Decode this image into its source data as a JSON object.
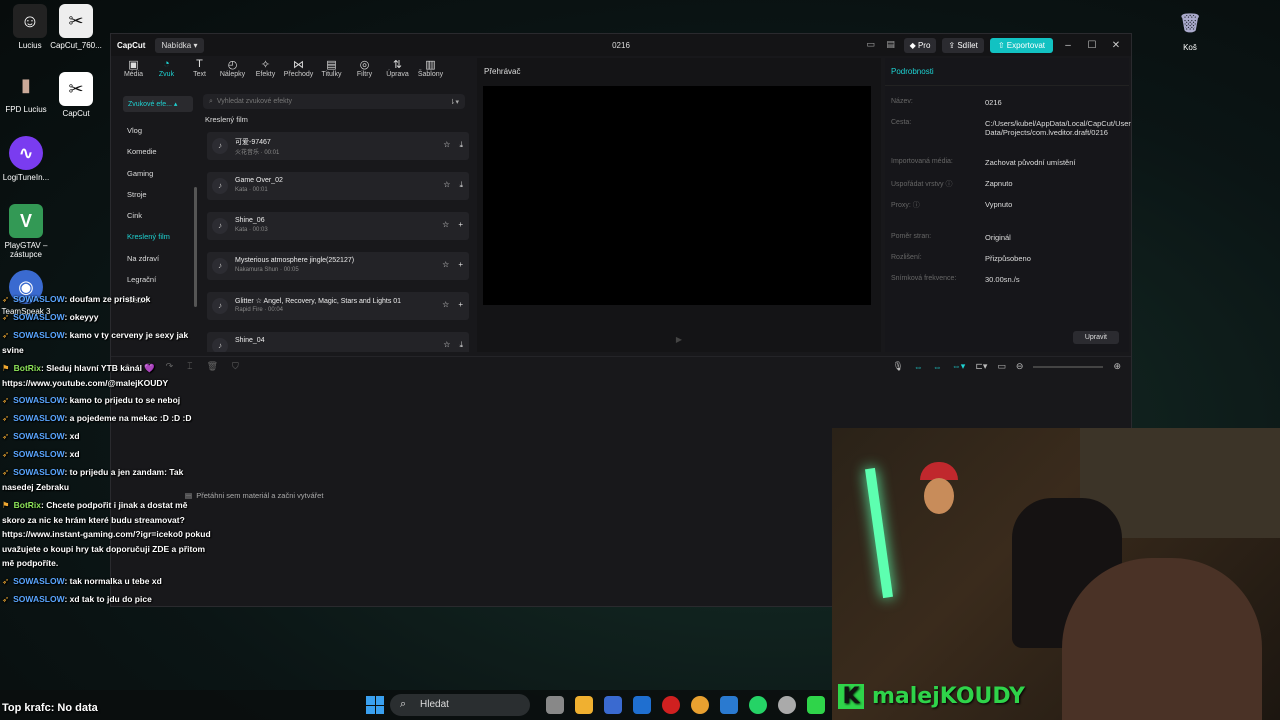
{
  "desktop": {
    "icons": [
      {
        "label": "Lucius",
        "glyph": "☺",
        "color": "#222"
      },
      {
        "label": "CapCut_760...",
        "glyph": "✂",
        "color": "#eee"
      },
      {
        "label": "FPD Lucius",
        "glyph": "▮",
        "color": "#444"
      },
      {
        "label": "CapCut",
        "glyph": "✂",
        "color": "#fff"
      },
      {
        "label": "LogiTuneIn...",
        "glyph": "∿",
        "color": "#7a3cf0"
      },
      {
        "label": "PlayGTAV – zástupce",
        "glyph": "V",
        "color": "#395"
      },
      {
        "label": "TeamSpeak 3",
        "glyph": "◉",
        "color": "#3a6ad0"
      },
      {
        "label": "Koš",
        "glyph": "🗑",
        "color": "#aac"
      }
    ]
  },
  "app": {
    "logo": "CapCut",
    "menu_label": "Nabídka",
    "project_title": "0216",
    "pro_label": "Pro",
    "share_label": "Sdílet",
    "export_label": "Exportovat"
  },
  "tools": [
    {
      "label": "Média",
      "glyph": "▣"
    },
    {
      "label": "Zvuk",
      "glyph": "◔"
    },
    {
      "label": "Text",
      "glyph": "T"
    },
    {
      "label": "Nálepky",
      "glyph": "◴"
    },
    {
      "label": "Efekty",
      "glyph": "✧"
    },
    {
      "label": "Přechody",
      "glyph": "⋈"
    },
    {
      "label": "Titulky",
      "glyph": "▤"
    },
    {
      "label": "Filtry",
      "glyph": "◎"
    },
    {
      "label": "Úprava",
      "glyph": "⇅"
    },
    {
      "label": "Šablony",
      "glyph": "▥"
    }
  ],
  "sidebar": {
    "dropdown": "Zvukové efe...",
    "categories": [
      "Vlog",
      "Komedie",
      "Gaming",
      "Stroje",
      "Cink",
      "Kreslený film",
      "Na zdraví",
      "Legrační",
      "Město"
    ],
    "active": "Kreslený film"
  },
  "audio": {
    "search_placeholder": "Vyhledat zvukové efekty",
    "section": "Kreslený film",
    "tracks": [
      {
        "name": "可爱-97467",
        "meta": "火花音乐 · 00:01"
      },
      {
        "name": "Game Over_02",
        "meta": "Kata · 00:01"
      },
      {
        "name": "Shine_06",
        "meta": "Kata · 00:03"
      },
      {
        "name": "Mysterious atmosphere jingle(252127)",
        "meta": "Nakamura Shun · 00:05"
      },
      {
        "name": "Glitter ☆ Angel, Recovery, Magic, Stars and Lights 01",
        "meta": "Rapid Fire · 00:04"
      },
      {
        "name": "Shine_04",
        "meta": ""
      }
    ]
  },
  "player": {
    "title": "Přehrávač"
  },
  "details": {
    "title": "Podrobnosti",
    "rows": [
      {
        "key": "Název:",
        "value": "0216"
      },
      {
        "key": "Cesta:",
        "value": "C:/Users/kubel/AppData/Local/CapCut/User Data/Projects/com.lveditor.draft/0216"
      },
      {
        "key": "Importovaná média:",
        "value": "Zachovat původní umístění"
      },
      {
        "key": "Uspořádat vrstvy ⓘ",
        "value": "Zapnuto"
      },
      {
        "key": "Proxy: ⓘ",
        "value": "Vypnuto"
      },
      {
        "key": "Poměr stran:",
        "value": "Originál"
      },
      {
        "key": "Rozlišení:",
        "value": "Přizpůsobeno"
      },
      {
        "key": "Snímková frekvence:",
        "value": "30.00sn./s"
      }
    ],
    "edit_label": "Upravit"
  },
  "timeline": {
    "drop_hint": "Přetáhni sem materiál a začni vytvářet"
  },
  "chat": [
    {
      "user": "SOWASLOW",
      "text": ": doufam ze pristi rok",
      "bot": false
    },
    {
      "user": "SOWASLOW",
      "text": ": okeyyy",
      "bot": false
    },
    {
      "user": "SOWASLOW",
      "text": ": kamo v ty cerveny je sexy jak svine",
      "bot": false
    },
    {
      "user": "BotRix",
      "text": ": Sleduj hlavní YTB kanál 💜 https://www.youtube.com/@malejKOUDY",
      "bot": true
    },
    {
      "user": "SOWASLOW",
      "text": ": kamo to prijedu to se neboj",
      "bot": false
    },
    {
      "user": "SOWASLOW",
      "text": ": a pojedeme na mekac :D :D :D",
      "bot": false
    },
    {
      "user": "SOWASLOW",
      "text": ": xd",
      "bot": false
    },
    {
      "user": "SOWASLOW",
      "text": ": xd",
      "bot": false
    },
    {
      "user": "SOWASLOW",
      "text": ": to prijedu a jen zandam: Tak nasedej Zebraku",
      "bot": false
    },
    {
      "user": "BotRix",
      "text": ": Chcete podpořit i jinak a dostat mě skoro za nic ke hrám které budu streamovat? https://www.instant-gaming.com/?igr=iceko0 pokud uvažujete o koupi hry tak doporučuji ZDE a přitom mě podpoříte.",
      "bot": true
    },
    {
      "user": "SOWASLOW",
      "text": ": tak normalka u tebe xd",
      "bot": false
    },
    {
      "user": "SOWASLOW",
      "text": ": xd tak to jdu do pice",
      "bot": false
    }
  ],
  "stream": {
    "brand": "malejKOUDY",
    "top_krafc": "Top krafc: No data"
  },
  "taskbar": {
    "search_label": "Hledat",
    "apps": [
      "#888",
      "#f0b030",
      "#3a6ad0",
      "#1f6fd0",
      "#d02020",
      "#e8a030",
      "#2a7ad0",
      "#25d366",
      "#aaa",
      "#2fd44a"
    ]
  }
}
